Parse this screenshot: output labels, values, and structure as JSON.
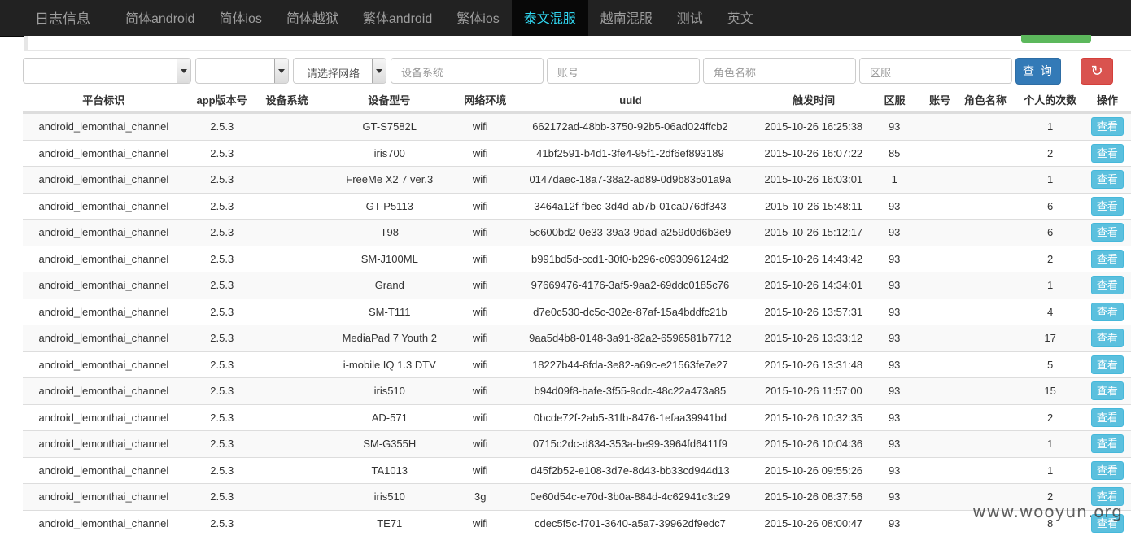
{
  "nav": {
    "brand": "日志信息",
    "items": [
      {
        "label": "简体android",
        "active": false
      },
      {
        "label": "简体ios",
        "active": false
      },
      {
        "label": "简体越狱",
        "active": false
      },
      {
        "label": "繁体android",
        "active": false
      },
      {
        "label": "繁体ios",
        "active": false
      },
      {
        "label": "泰文混服",
        "active": true
      },
      {
        "label": "越南混服",
        "active": false
      },
      {
        "label": "测试",
        "active": false
      },
      {
        "label": "英文",
        "active": false
      }
    ]
  },
  "filters": {
    "select1_value": "",
    "select2_value": "",
    "network_select_value": "请选择网络",
    "device_os_placeholder": "设备系统",
    "account_placeholder": "账号",
    "role_placeholder": "角色名称",
    "zone_placeholder": "区服",
    "query_label": "查 询",
    "refresh_icon": "refresh-icon"
  },
  "colors": {
    "navbar": "#222222",
    "active_nav_text": "#31d7f1",
    "primary": "#337ab7",
    "danger": "#d9534f",
    "info": "#5bc0de"
  },
  "table": {
    "headers": {
      "platform": "平台标识",
      "app_version": "app版本号",
      "device_os": "设备系统",
      "device_model": "设备型号",
      "network": "网络环境",
      "uuid": "uuid",
      "time": "触发时间",
      "zone": "区服",
      "account": "账号",
      "role": "角色名称",
      "count": "个人的次数",
      "action": "操作"
    },
    "view_label": "查看",
    "rows": [
      {
        "platform": "android_lemonthai_channel",
        "app": "2.5.3",
        "os": "",
        "model": "GT-S7582L",
        "net": "wifi",
        "uuid": "662172ad-48bb-3750-92b5-06ad024ffcb2",
        "time": "2015-10-26 16:25:38",
        "zone": "93",
        "account": "",
        "role": "",
        "count": "1"
      },
      {
        "platform": "android_lemonthai_channel",
        "app": "2.5.3",
        "os": "",
        "model": "iris700",
        "net": "wifi",
        "uuid": "41bf2591-b4d1-3fe4-95f1-2df6ef893189",
        "time": "2015-10-26 16:07:22",
        "zone": "85",
        "account": "",
        "role": "",
        "count": "2"
      },
      {
        "platform": "android_lemonthai_channel",
        "app": "2.5.3",
        "os": "",
        "model": "FreeMe X2 7 ver.3",
        "net": "wifi",
        "uuid": "0147daec-18a7-38a2-ad89-0d9b83501a9a",
        "time": "2015-10-26 16:03:01",
        "zone": "1",
        "account": "",
        "role": "",
        "count": "1"
      },
      {
        "platform": "android_lemonthai_channel",
        "app": "2.5.3",
        "os": "",
        "model": "GT-P5113",
        "net": "wifi",
        "uuid": "3464a12f-fbec-3d4d-ab7b-01ca076df343",
        "time": "2015-10-26 15:48:11",
        "zone": "93",
        "account": "",
        "role": "",
        "count": "6"
      },
      {
        "platform": "android_lemonthai_channel",
        "app": "2.5.3",
        "os": "",
        "model": "T98",
        "net": "wifi",
        "uuid": "5c600bd2-0e33-39a3-9dad-a259d0d6b3e9",
        "time": "2015-10-26 15:12:17",
        "zone": "93",
        "account": "",
        "role": "",
        "count": "6"
      },
      {
        "platform": "android_lemonthai_channel",
        "app": "2.5.3",
        "os": "",
        "model": "SM-J100ML",
        "net": "wifi",
        "uuid": "b991bd5d-ccd1-30f0-b296-c093096124d2",
        "time": "2015-10-26 14:43:42",
        "zone": "93",
        "account": "",
        "role": "",
        "count": "2"
      },
      {
        "platform": "android_lemonthai_channel",
        "app": "2.5.3",
        "os": "",
        "model": "Grand",
        "net": "wifi",
        "uuid": "97669476-4176-3af5-9aa2-69ddc0185c76",
        "time": "2015-10-26 14:34:01",
        "zone": "93",
        "account": "",
        "role": "",
        "count": "1"
      },
      {
        "platform": "android_lemonthai_channel",
        "app": "2.5.3",
        "os": "",
        "model": "SM-T111",
        "net": "wifi",
        "uuid": "d7e0c530-dc5c-302e-87af-15a4bddfc21b",
        "time": "2015-10-26 13:57:31",
        "zone": "93",
        "account": "",
        "role": "",
        "count": "4"
      },
      {
        "platform": "android_lemonthai_channel",
        "app": "2.5.3",
        "os": "",
        "model": "MediaPad 7 Youth 2",
        "net": "wifi",
        "uuid": "9aa5d4b8-0148-3a91-82a2-6596581b7712",
        "time": "2015-10-26 13:33:12",
        "zone": "93",
        "account": "",
        "role": "",
        "count": "17"
      },
      {
        "platform": "android_lemonthai_channel",
        "app": "2.5.3",
        "os": "",
        "model": "i-mobile IQ 1.3 DTV",
        "net": "wifi",
        "uuid": "18227b44-8fda-3e82-a69c-e21563fe7e27",
        "time": "2015-10-26 13:31:48",
        "zone": "93",
        "account": "",
        "role": "",
        "count": "5"
      },
      {
        "platform": "android_lemonthai_channel",
        "app": "2.5.3",
        "os": "",
        "model": "iris510",
        "net": "wifi",
        "uuid": "b94d09f8-bafe-3f55-9cdc-48c22a473a85",
        "time": "2015-10-26 11:57:00",
        "zone": "93",
        "account": "",
        "role": "",
        "count": "15"
      },
      {
        "platform": "android_lemonthai_channel",
        "app": "2.5.3",
        "os": "",
        "model": "AD-571",
        "net": "wifi",
        "uuid": "0bcde72f-2ab5-31fb-8476-1efaa39941bd",
        "time": "2015-10-26 10:32:35",
        "zone": "93",
        "account": "",
        "role": "",
        "count": "2"
      },
      {
        "platform": "android_lemonthai_channel",
        "app": "2.5.3",
        "os": "",
        "model": "SM-G355H",
        "net": "wifi",
        "uuid": "0715c2dc-d834-353a-be99-3964fd6411f9",
        "time": "2015-10-26 10:04:36",
        "zone": "93",
        "account": "",
        "role": "",
        "count": "1"
      },
      {
        "platform": "android_lemonthai_channel",
        "app": "2.5.3",
        "os": "",
        "model": "TA1013",
        "net": "wifi",
        "uuid": "d45f2b52-e108-3d7e-8d43-bb33cd944d13",
        "time": "2015-10-26 09:55:26",
        "zone": "93",
        "account": "",
        "role": "",
        "count": "1"
      },
      {
        "platform": "android_lemonthai_channel",
        "app": "2.5.3",
        "os": "",
        "model": "iris510",
        "net": "3g",
        "uuid": "0e60d54c-e70d-3b0a-884d-4c62941c3c29",
        "time": "2015-10-26 08:37:56",
        "zone": "93",
        "account": "",
        "role": "",
        "count": "2"
      },
      {
        "platform": "android_lemonthai_channel",
        "app": "2.5.3",
        "os": "",
        "model": "TE71",
        "net": "wifi",
        "uuid": "cdec5f5c-f701-3640-a5a7-39962df9edc7",
        "time": "2015-10-26 08:00:47",
        "zone": "93",
        "account": "",
        "role": "",
        "count": "8"
      }
    ]
  },
  "watermark": "www.wooyun.org"
}
